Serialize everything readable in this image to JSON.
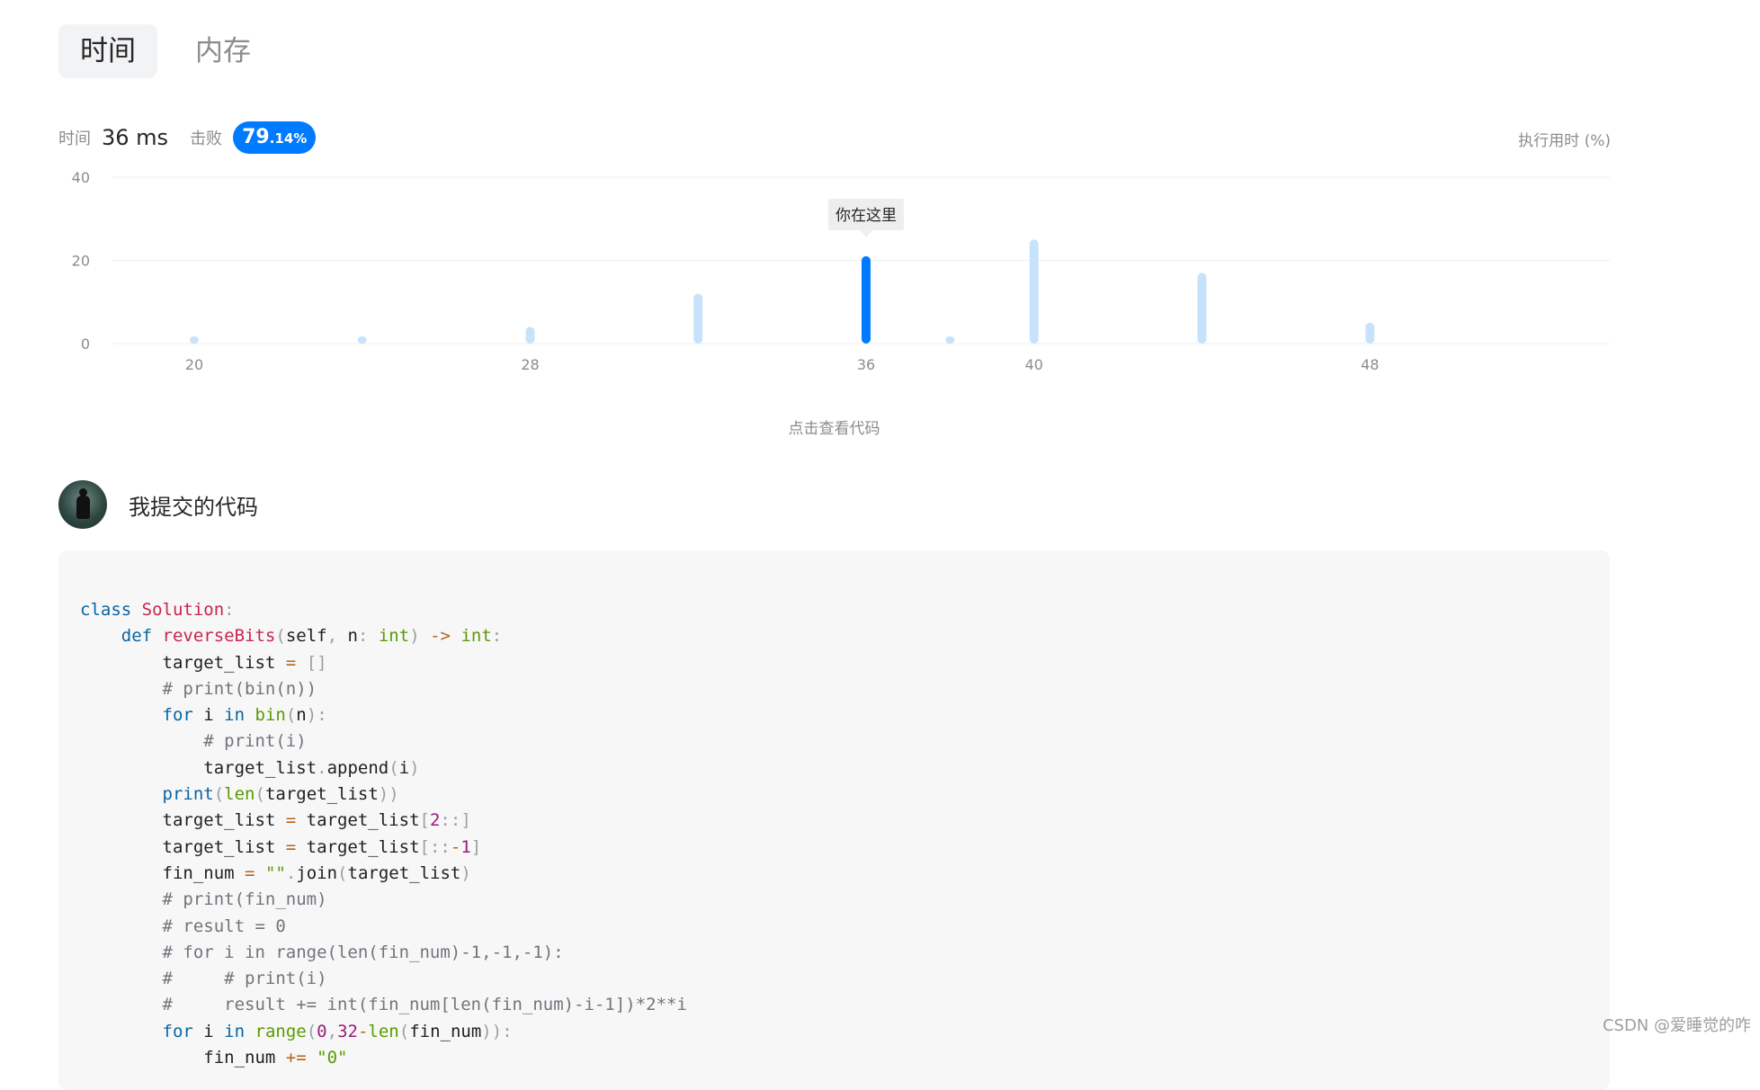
{
  "tabs": [
    {
      "label": "时间",
      "active": true
    },
    {
      "label": "内存",
      "active": false
    }
  ],
  "stats": {
    "time_label": "时间",
    "time_value": "36 ms",
    "beat_label": "击败",
    "beat_main": "79",
    "beat_decimal": ".14%",
    "legend": "执行用时 (%)"
  },
  "chart_data": {
    "type": "bar",
    "x": [
      20,
      24,
      28,
      32,
      36,
      38,
      40,
      44,
      48
    ],
    "values": [
      1,
      1,
      4,
      12,
      21,
      1,
      25,
      17,
      5
    ],
    "highlight_x": 36,
    "highlight_label": "你在这里",
    "xticks": [
      20,
      28,
      36,
      40,
      48
    ],
    "yticks": [
      0,
      20,
      40
    ],
    "ylim": [
      0,
      40
    ],
    "grid": true,
    "colors": {
      "bar": "#c7e3fb",
      "highlight": "#007aff"
    }
  },
  "view_code_label": "点击查看代码",
  "submission": {
    "title": "我提交的代码"
  },
  "code_lines": [
    "class Solution:",
    "    def reverseBits(self, n: int) -> int:",
    "        target_list = []",
    "        # print(bin(n))",
    "        for i in bin(n):",
    "            # print(i)",
    "            target_list.append(i)",
    "        print(len(target_list))",
    "        target_list = target_list[2::]",
    "        target_list = target_list[::-1]",
    "        fin_num = \"\".join(target_list)",
    "        # print(fin_num)",
    "        # result = 0",
    "        # for i in range(len(fin_num)-1,-1,-1):",
    "        #     # print(i)",
    "        #     result += int(fin_num[len(fin_num)-i-1])*2**i",
    "        for i in range(0,32-len(fin_num)):",
    "            fin_num += \"0\""
  ],
  "watermark": "CSDN @爱睡觉的咋"
}
